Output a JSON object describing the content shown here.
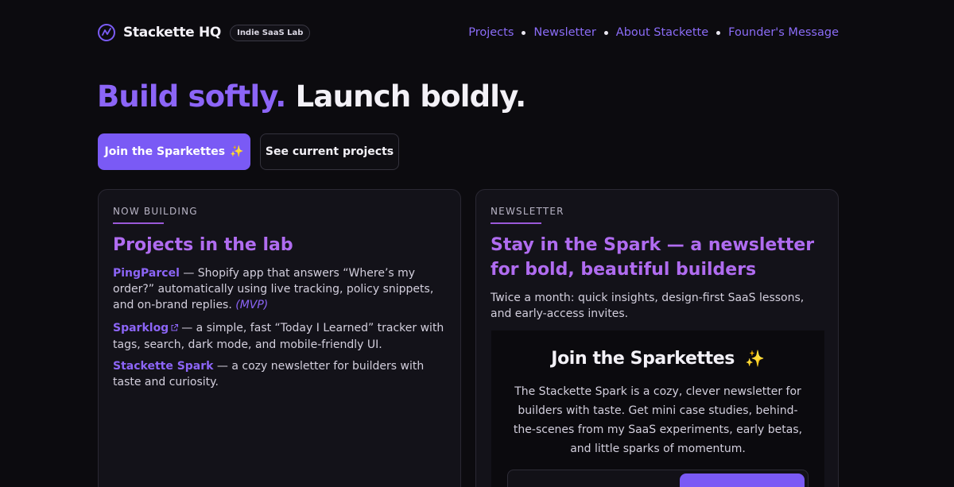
{
  "header": {
    "brand_name": "Stackette HQ",
    "brand_badge": "Indie SaaS Lab",
    "logo_icon": "bolt-circle-icon",
    "nav": [
      "Projects",
      "Newsletter",
      "About Stackette",
      "Founder's Message"
    ]
  },
  "hero": {
    "title_accent": "Build softly.",
    "title_plain": "Launch boldly.",
    "primary_button": "Join the Sparkettes",
    "secondary_button": "See current projects",
    "sparkle": "✨"
  },
  "projects_card": {
    "eyebrow": "NOW BUILDING",
    "title": "Projects in the lab",
    "items": [
      {
        "name": "PingParcel",
        "desc": " — Shopify app that answers “Where’s my order?” automatically using live tracking, policy snippets, and on-brand replies. ",
        "tag": "(MVP)"
      },
      {
        "name": "Sparklog",
        "desc": "— a simple, fast “Today I Learned” tracker with tags, search, dark mode, and mobile-friendly UI."
      },
      {
        "name": "Stackette Spark",
        "desc": " — a cozy newsletter for builders with taste and curiosity."
      }
    ]
  },
  "newsletter_card": {
    "eyebrow": "NEWSLETTER",
    "title": "Stay in the Spark — a newsletter for bold, beautiful builders",
    "description": "Twice a month: quick insights, design-first SaaS lessons, and early-access invites.",
    "signup": {
      "title": "Join the Sparkettes",
      "body": "The Stackette Spark is a cozy, clever newsletter for builders with taste. Get mini case studies, behind-the-scenes from my SaaS experiments, early betas, and little sparks of momentum."
    }
  },
  "colors": {
    "background": "#0c0b0f",
    "accent": "#7a5af5",
    "card_title": "#b06cf0",
    "link": "#8c65f7"
  }
}
